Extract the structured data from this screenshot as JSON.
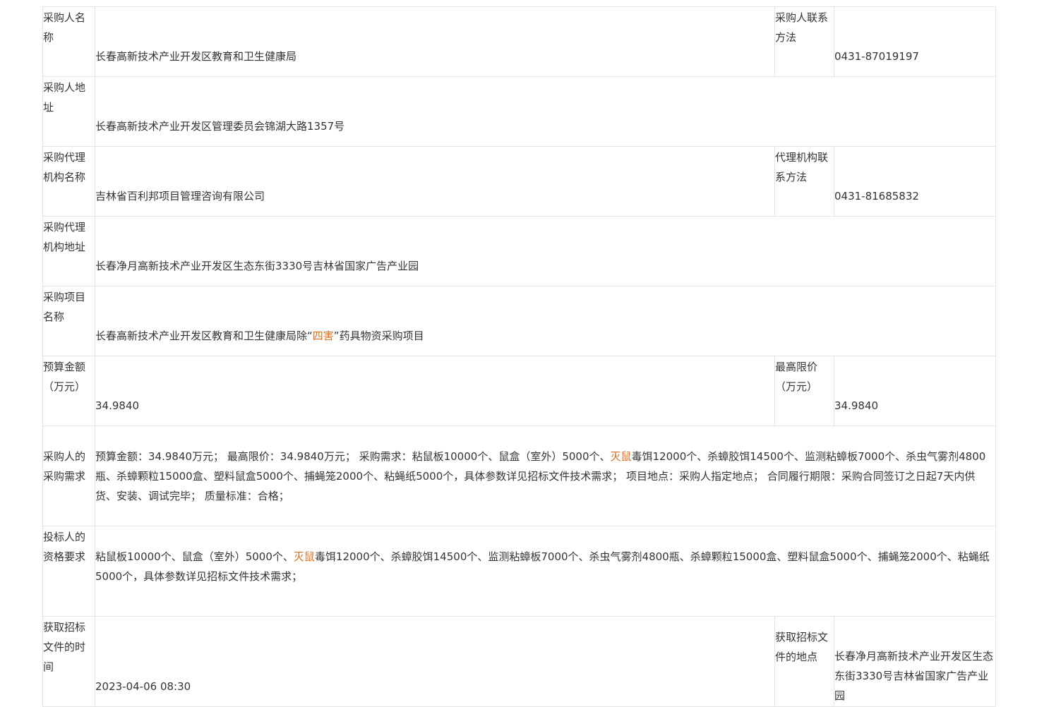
{
  "rows": {
    "purchaser_name": {
      "label": "采购人名称",
      "value": "长春高新技术产业开发区教育和卫生健康局",
      "contact_label": "采购人联系方法",
      "contact_value": "0431-87019197"
    },
    "purchaser_address": {
      "label": "采购人地址",
      "value": "长春高新技术产业开发区管理委员会锦湖大路1357号"
    },
    "agency_name": {
      "label": "采购代理机构名称",
      "value": "吉林省百利邦项目管理咨询有限公司",
      "contact_label": "代理机构联系方法",
      "contact_value": "0431-81685832"
    },
    "agency_address": {
      "label": "采购代理机构地址",
      "value": "长春净月高新技术产业开发区生态东街3330号吉林省国家广告产业园"
    },
    "project_name": {
      "label": "采购项目名称",
      "value_prefix": "长春高新技术产业开发区教育和卫生健康局除“",
      "value_highlight": "四害",
      "value_suffix": "”药具物资采购项目"
    },
    "budget": {
      "label": "预算金额（万元）",
      "value": "34.9840",
      "max_label": "最高限价（万元）",
      "max_value": "34.9840"
    },
    "requirements": {
      "label": "采购人的采购需求",
      "text_prefix": "预算金额：34.9840万元； 最高限价：34.9840万元； 采购需求：粘鼠板10000个、鼠盒（室外）5000个、",
      "text_highlight": "灭鼠",
      "text_suffix": "毒饵12000个、杀蟑胶饵14500个、监测粘蟑板7000个、杀虫气雾剂4800瓶、杀蟑颗粒15000盒、塑料鼠盒5000个、捕蝇笼2000个、粘蝇纸5000个，具体参数详见招标文件技术需求； 项目地点：采购人指定地点； 合同履行期限：采购合同签订之日起7天内供货、安装、调试完毕； 质量标准：合格；"
    },
    "qualification": {
      "label": "投标人的资格要求",
      "text_prefix": "粘鼠板10000个、鼠盒（室外）5000个、",
      "text_highlight": "灭鼠",
      "text_suffix": "毒饵12000个、杀蟑胶饵14500个、监测粘蟑板7000个、杀虫气雾剂4800瓶、杀蟑颗粒15000盒、塑料鼠盒5000个、捕蝇笼2000个、粘蝇纸5000个，具体参数详见招标文件技术需求；"
    },
    "doc_time": {
      "label": "获取招标文件的时间",
      "value": "2023-04-06 08:30",
      "place_label": "获取招标文件的地点",
      "place_value": "长春净月高新技术产业开发区生态东街3330号吉林省国家广告产业园"
    }
  },
  "colors": {
    "highlight": "#e06b1a",
    "border": "#e3e3e3",
    "text": "#333333"
  }
}
